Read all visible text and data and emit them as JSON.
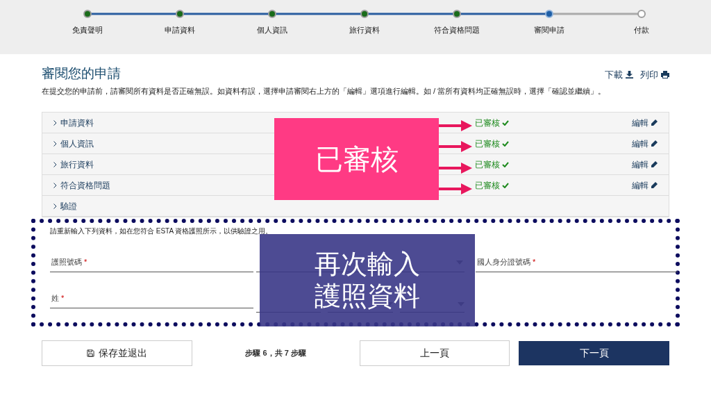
{
  "stepper": [
    {
      "label": "免責聲明",
      "completed": true,
      "selected": false
    },
    {
      "label": "申請資料",
      "completed": true,
      "selected": false
    },
    {
      "label": "個人資訊",
      "completed": true,
      "selected": false
    },
    {
      "label": "旅行資料",
      "completed": true,
      "selected": false
    },
    {
      "label": "符合資格問題",
      "completed": true,
      "selected": false
    },
    {
      "label": "審閱申請",
      "completed": false,
      "selected": true
    },
    {
      "label": "付款",
      "completed": false,
      "selected": false
    }
  ],
  "review": {
    "title": "審閱您的申請",
    "intro": "在提交您的申請前，請審閱所有資料是否正確無誤。如資料有誤，選擇申請審閱右上方的「編輯」選項進行編輯。如 / 當所有資料均正確無誤時，選擇「確認並繼續」。",
    "download": "下載",
    "print": "列印",
    "sections": [
      {
        "label": "申請資料",
        "status": "已審核",
        "edit": "編輯"
      },
      {
        "label": "個人資訊",
        "status": "已審核",
        "edit": "編輯"
      },
      {
        "label": "旅行資料",
        "status": "已審核",
        "edit": "編輯"
      },
      {
        "label": "符合資格問題",
        "status": "已審核",
        "edit": "編輯"
      },
      {
        "label": "驗證"
      }
    ]
  },
  "verification": {
    "note": "請重新輸入下列資料，如在您符合 ESTA 資格護照所示，以供驗證之用。",
    "fields": [
      {
        "kind": "text",
        "label": "護照號碼",
        "mark": "*"
      },
      {
        "kind": "select"
      },
      {
        "kind": "text",
        "label": "國人身分證號碼",
        "mark": "*"
      },
      {
        "kind": "text",
        "label": "姓",
        "mark": "*"
      },
      {
        "kind": "date"
      }
    ]
  },
  "footer": {
    "save": "保存並退出",
    "step": "步驟 6，共 7 步驟",
    "prev": "上一頁",
    "next": "下一頁"
  },
  "annotations": [
    {
      "kind": "pink",
      "lines": [
        "已審核"
      ]
    },
    {
      "kind": "blue",
      "lines": [
        "再次輸入",
        "護照資料"
      ]
    }
  ]
}
